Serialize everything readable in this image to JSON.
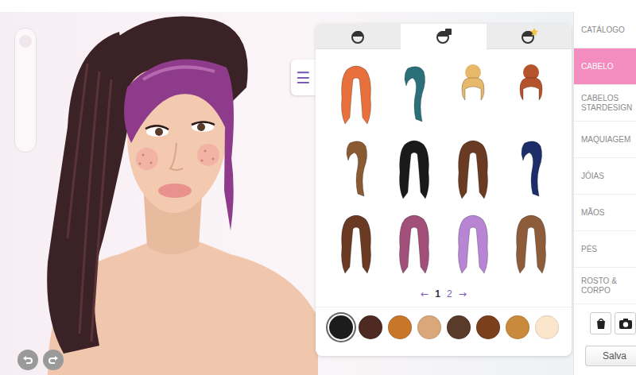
{
  "sidebar": {
    "items": [
      {
        "label": "CATÁLOGO",
        "selected": false
      },
      {
        "label": "CABELO",
        "selected": true
      },
      {
        "label": "CABELOS STARDESIGN",
        "selected": false
      },
      {
        "label": "MAQUIAGEM",
        "selected": false
      },
      {
        "label": "JÓIAS",
        "selected": false
      },
      {
        "label": "MÃOS",
        "selected": false
      },
      {
        "label": "PÉS",
        "selected": false
      },
      {
        "label": "ROSTO & CORPO",
        "selected": false
      }
    ],
    "save_button": "Salva"
  },
  "menu_toggle": "☰",
  "panel": {
    "tabs": [
      {
        "selected": false
      },
      {
        "selected": true
      },
      {
        "selected": false
      }
    ],
    "hairstyles": [
      {
        "kind": "long",
        "color": "#e8703c"
      },
      {
        "kind": "side",
        "color": "#2b6f7a"
      },
      {
        "kind": "bun",
        "color": "#e7b86a"
      },
      {
        "kind": "bun",
        "color": "#b5532c"
      },
      {
        "kind": "side",
        "color": "#8a5a33"
      },
      {
        "kind": "long",
        "color": "#1a1a1a"
      },
      {
        "kind": "long",
        "color": "#6b3a22"
      },
      {
        "kind": "side",
        "color": "#1d2d6a"
      },
      {
        "kind": "long",
        "color": "#6b3a22"
      },
      {
        "kind": "long",
        "color": "#a24f7a"
      },
      {
        "kind": "long",
        "color": "#b785d4"
      },
      {
        "kind": "long",
        "color": "#8d5c3a"
      }
    ],
    "pagination": {
      "prev": "←",
      "pages": [
        {
          "label": "1",
          "selected": true
        },
        {
          "label": "2",
          "selected": false
        }
      ],
      "next": "→"
    },
    "swatches": [
      {
        "color": "#1c1c1c",
        "selected": true
      },
      {
        "color": "#4e2a22",
        "selected": false
      },
      {
        "color": "#c7762a",
        "selected": false
      },
      {
        "color": "#d9a77a",
        "selected": false
      },
      {
        "color": "#5a3a2a",
        "selected": false
      },
      {
        "color": "#7a3f1c",
        "selected": false
      },
      {
        "color": "#c98a3e",
        "selected": false
      },
      {
        "color": "#fbe5cc",
        "selected": false
      }
    ]
  }
}
